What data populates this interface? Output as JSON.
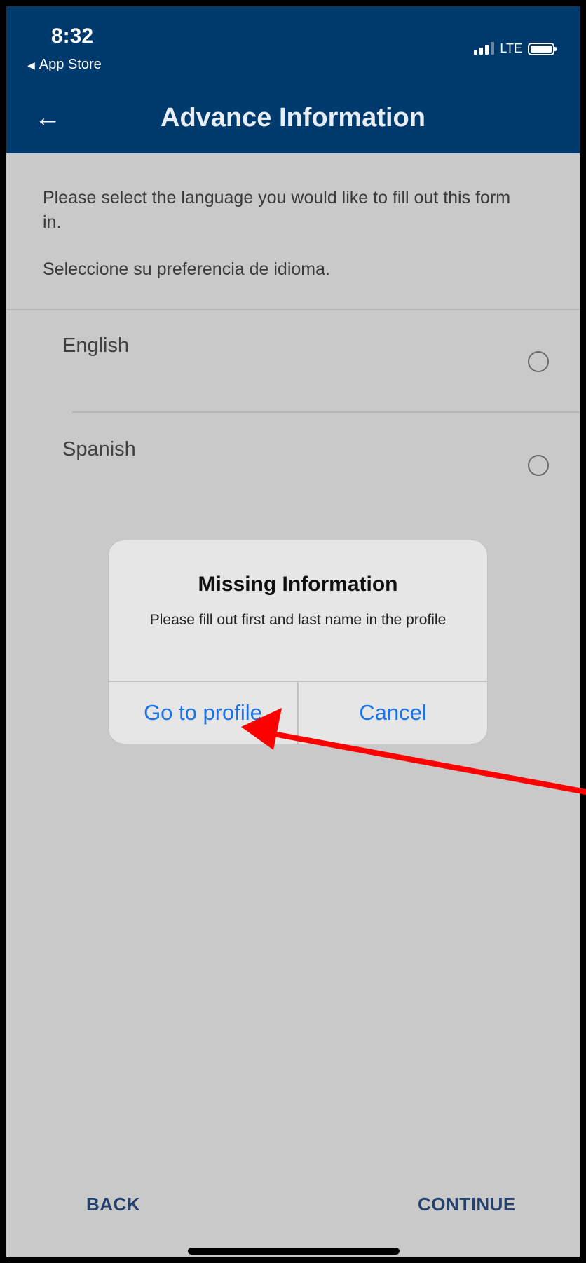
{
  "status_bar": {
    "time": "8:32",
    "back_app": "App Store",
    "network": "LTE"
  },
  "nav": {
    "back_icon": "arrow-left-icon",
    "title": "Advance Information"
  },
  "intro": {
    "prompt_en": "Please select the language you would like to fill out this form in.",
    "prompt_es": "Seleccione su preferencia de idioma."
  },
  "options": [
    {
      "label": "English",
      "selected": false
    },
    {
      "label": "Spanish",
      "selected": false
    }
  ],
  "dialog": {
    "title": "Missing Information",
    "message": "Please fill out first and last name in the profile",
    "primary_label": "Go to profile",
    "secondary_label": "Cancel"
  },
  "footer": {
    "back_label": "BACK",
    "continue_label": "CONTINUE"
  },
  "colors": {
    "header_bg": "#003a6d",
    "dialog_button_text": "#1a73e8",
    "annotation_arrow": "#ff0000"
  }
}
